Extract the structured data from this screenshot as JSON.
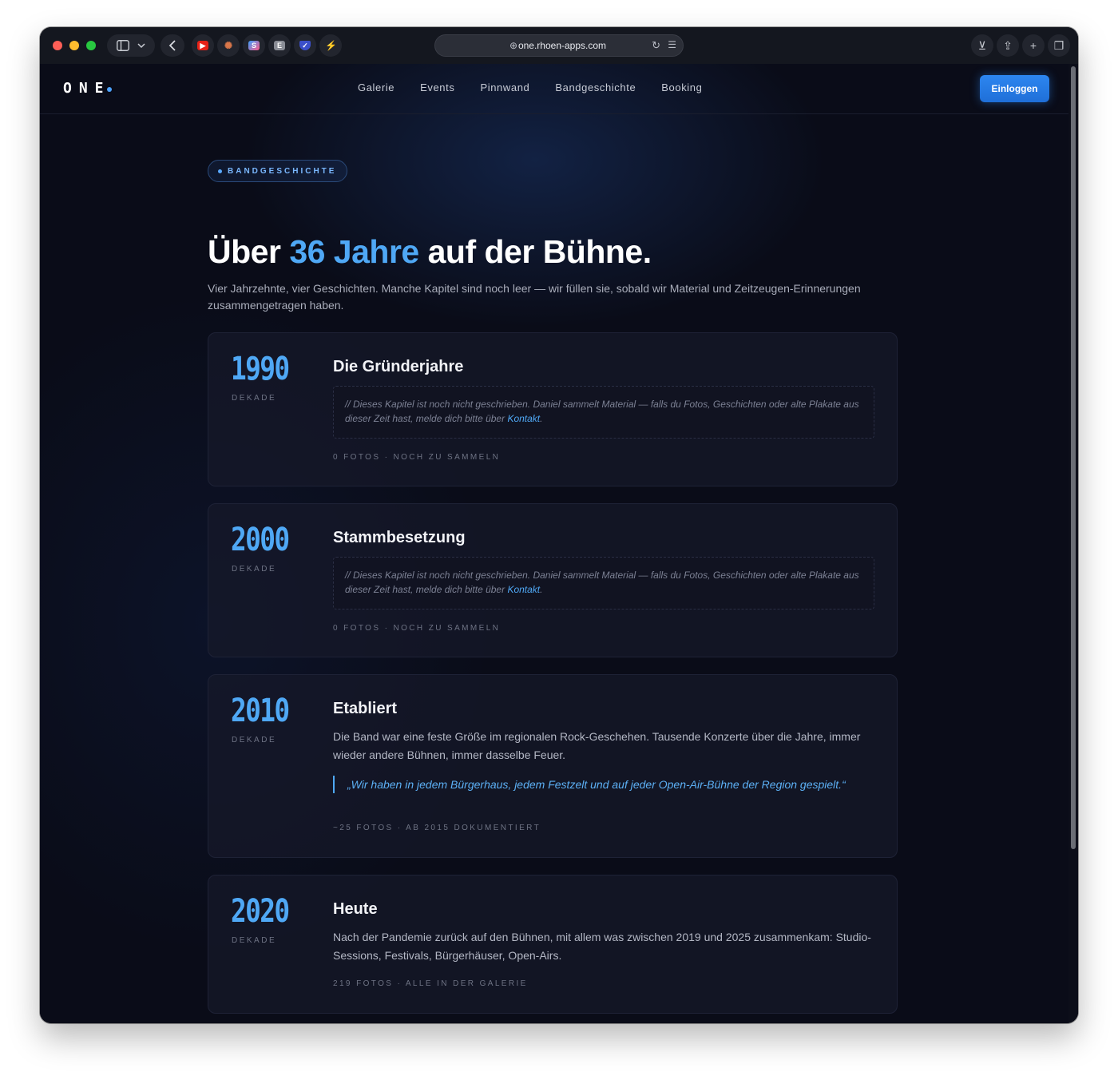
{
  "browser": {
    "url": "one.rhoen-apps.com"
  },
  "nav": {
    "logo": "ONE",
    "links": [
      "Galerie",
      "Events",
      "Pinnwand",
      "Bandgeschichte",
      "Booking"
    ],
    "login_label": "Einloggen"
  },
  "hero": {
    "badge": "BANDGESCHICHTE",
    "headline_before": "Über ",
    "headline_accent": "36 Jahre",
    "headline_after": " auf der Bühne.",
    "intro": "Vier Jahrzehnte, vier Geschichten. Manche Kapitel sind noch leer — wir füllen sie, sobald wir Material und Zeitzeugen-Erinnerungen zusammengetragen haben."
  },
  "decades": [
    {
      "year": "1990",
      "label": "DEKADE",
      "title": "Die Gründerjahre",
      "note_text": "// Dieses Kapitel ist noch nicht geschrieben. Daniel sammelt Material — falls du Fotos, Geschichten oder alte Plakate aus dieser Zeit hast, melde dich bitte über ",
      "note_link": "Kontakt",
      "note_end": ".",
      "meta": "0 FOTOS · NOCH ZU SAMMELN"
    },
    {
      "year": "2000",
      "label": "DEKADE",
      "title": "Stammbesetzung",
      "note_text": "// Dieses Kapitel ist noch nicht geschrieben. Daniel sammelt Material — falls du Fotos, Geschichten oder alte Plakate aus dieser Zeit hast, melde dich bitte über ",
      "note_link": "Kontakt",
      "note_end": ".",
      "meta": "0 FOTOS · NOCH ZU SAMMELN"
    },
    {
      "year": "2010",
      "label": "DEKADE",
      "title": "Etabliert",
      "description": "Die Band war eine feste Größe im regionalen Rock-Geschehen. Tausende Konzerte über die Jahre, immer wieder andere Bühnen, immer dasselbe Feuer.",
      "quote": "„Wir haben in jedem Bürgerhaus, jedem Festzelt und auf jeder Open-Air-Bühne der Region gespielt.“",
      "meta": "~25 FOTOS · AB 2015 DOKUMENTIERT"
    },
    {
      "year": "2020",
      "label": "DEKADE",
      "title": "Heute",
      "description": "Nach der Pandemie zurück auf den Bühnen, mit allem was zwischen 2019 und 2025 zusammenkam: Studio-Sessions, Festivals, Bürgerhäuser, Open-Airs.",
      "meta": "219 FOTOS · ALLE IN DER GALERIE"
    }
  ]
}
